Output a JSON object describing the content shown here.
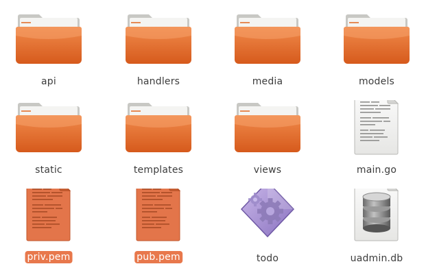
{
  "files": [
    {
      "name": "api",
      "kind": "folder",
      "icon": "folder-icon",
      "selected": false
    },
    {
      "name": "handlers",
      "kind": "folder",
      "icon": "folder-icon",
      "selected": false
    },
    {
      "name": "media",
      "kind": "folder",
      "icon": "folder-icon",
      "selected": false
    },
    {
      "name": "models",
      "kind": "folder",
      "icon": "folder-icon",
      "selected": false
    },
    {
      "name": "static",
      "kind": "folder",
      "icon": "folder-icon",
      "selected": false
    },
    {
      "name": "templates",
      "kind": "folder",
      "icon": "folder-icon",
      "selected": false
    },
    {
      "name": "views",
      "kind": "folder",
      "icon": "folder-icon",
      "selected": false
    },
    {
      "name": "main.go",
      "kind": "text",
      "icon": "text-file-icon",
      "selected": false
    },
    {
      "name": "priv.pem",
      "kind": "text",
      "icon": "text-file-icon",
      "selected": true
    },
    {
      "name": "pub.pem",
      "kind": "text",
      "icon": "text-file-icon",
      "selected": true
    },
    {
      "name": "todo",
      "kind": "executable",
      "icon": "executable-icon",
      "selected": false
    },
    {
      "name": "uadmin.db",
      "kind": "database",
      "icon": "database-icon",
      "selected": false
    }
  ],
  "colors": {
    "selection": "#e8784c",
    "folder": "#e46b2c"
  }
}
